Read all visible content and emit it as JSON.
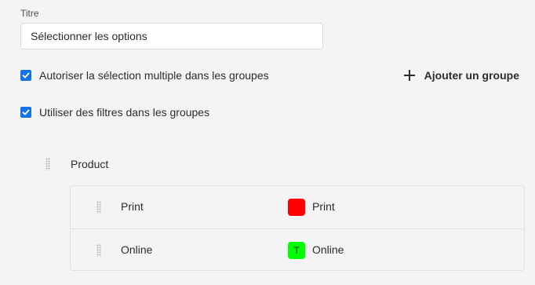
{
  "form": {
    "title_label": "Titre",
    "title_value": "Sélectionner les options",
    "allow_multi_label": "Autoriser la sélection multiple dans les groupes",
    "allow_multi_checked": true,
    "use_filters_label": "Utiliser des filtres dans les groupes",
    "use_filters_checked": true,
    "add_group_label": "Ajouter un groupe"
  },
  "group": {
    "title": "Product",
    "options": [
      {
        "name": "Print",
        "swatch_label": "Print",
        "swatch_color": "#ff0000",
        "swatch_text": ""
      },
      {
        "name": "Online",
        "swatch_label": "Online",
        "swatch_color": "#00ff00",
        "swatch_text": "T"
      }
    ]
  },
  "colors": {
    "accent": "#1473e6",
    "background": "#f4f4f4"
  }
}
